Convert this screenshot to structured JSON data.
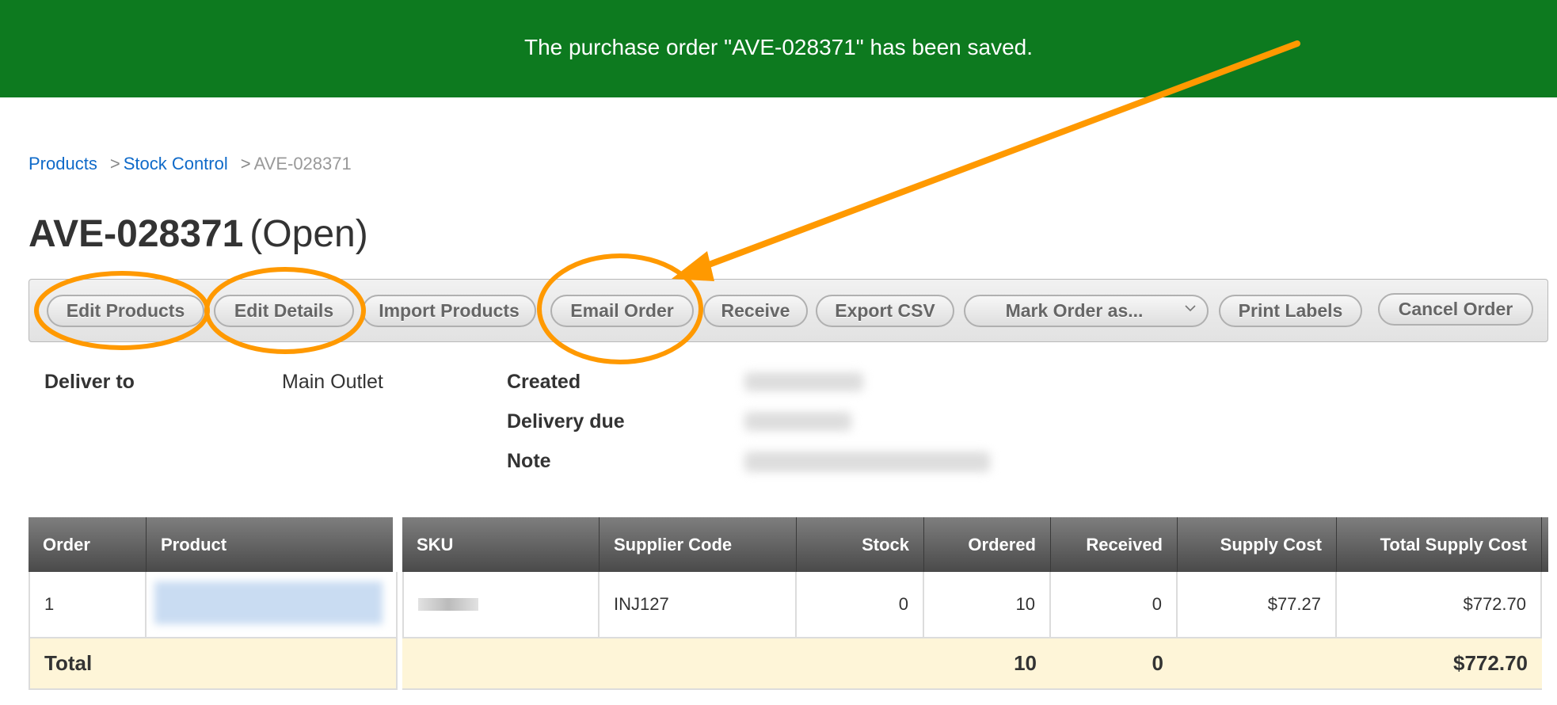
{
  "banner": {
    "message": "The purchase order \"AVE-028371\" has been saved."
  },
  "breadcrumb": [
    {
      "label": "Products"
    },
    {
      "sep": ">",
      "label": "Stock Control"
    },
    {
      "sep": ">",
      "label": "AVE-028371"
    }
  ],
  "page": {
    "order_number": "AVE-028371",
    "status": "(Open)"
  },
  "toolbar": {
    "edit_products": "Edit Products",
    "edit_details": "Edit Details",
    "import_products": "Import Products",
    "email_order": "Email Order",
    "receive": "Receive",
    "export_csv": "Export CSV",
    "mark_order_as": "Mark Order as...",
    "print_labels": "Print Labels",
    "cancel_order": "Cancel Order"
  },
  "details": {
    "deliver_to_label": "Deliver to",
    "deliver_to_value": "Main Outlet",
    "created_label": "Created",
    "delivery_due_label": "Delivery due",
    "note_label": "Note"
  },
  "table": {
    "headers": [
      "Order",
      "Product",
      "SKU",
      "Supplier Code",
      "Stock",
      "Ordered",
      "Received",
      "Supply Cost",
      "Total Supply Cost"
    ],
    "rows": [
      {
        "order": "1",
        "product": "",
        "sku": "",
        "supplier_code": "INJ127",
        "stock": "0",
        "ordered": "10",
        "received": "0",
        "supply_cost": "$77.27",
        "total_supply_cost": "$772.70"
      }
    ],
    "total": {
      "label": "Total",
      "ordered": "10",
      "received": "0",
      "total_supply_cost": "$772.70"
    }
  },
  "colors": {
    "banner": "#0d7a1f",
    "annotation": "#ff9900",
    "link": "#0f6ac9",
    "total_row": "#fef5d8"
  }
}
